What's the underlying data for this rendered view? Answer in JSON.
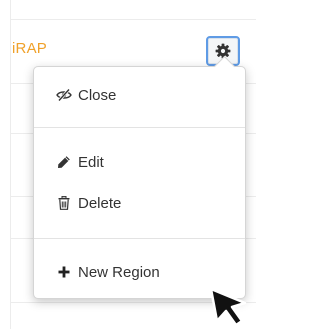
{
  "region": {
    "name": "iRAP",
    "name_color": "#f0a12a"
  },
  "settings_button": {
    "icon": "gear-icon",
    "border_color": "#5f9be5"
  },
  "menu": {
    "items": [
      {
        "label": "Close",
        "icon": "eye-slash-icon"
      },
      {
        "label": "Edit",
        "icon": "pencil-icon"
      },
      {
        "label": "Delete",
        "icon": "trash-icon"
      },
      {
        "label": "New Region",
        "icon": "plus-icon"
      }
    ]
  }
}
